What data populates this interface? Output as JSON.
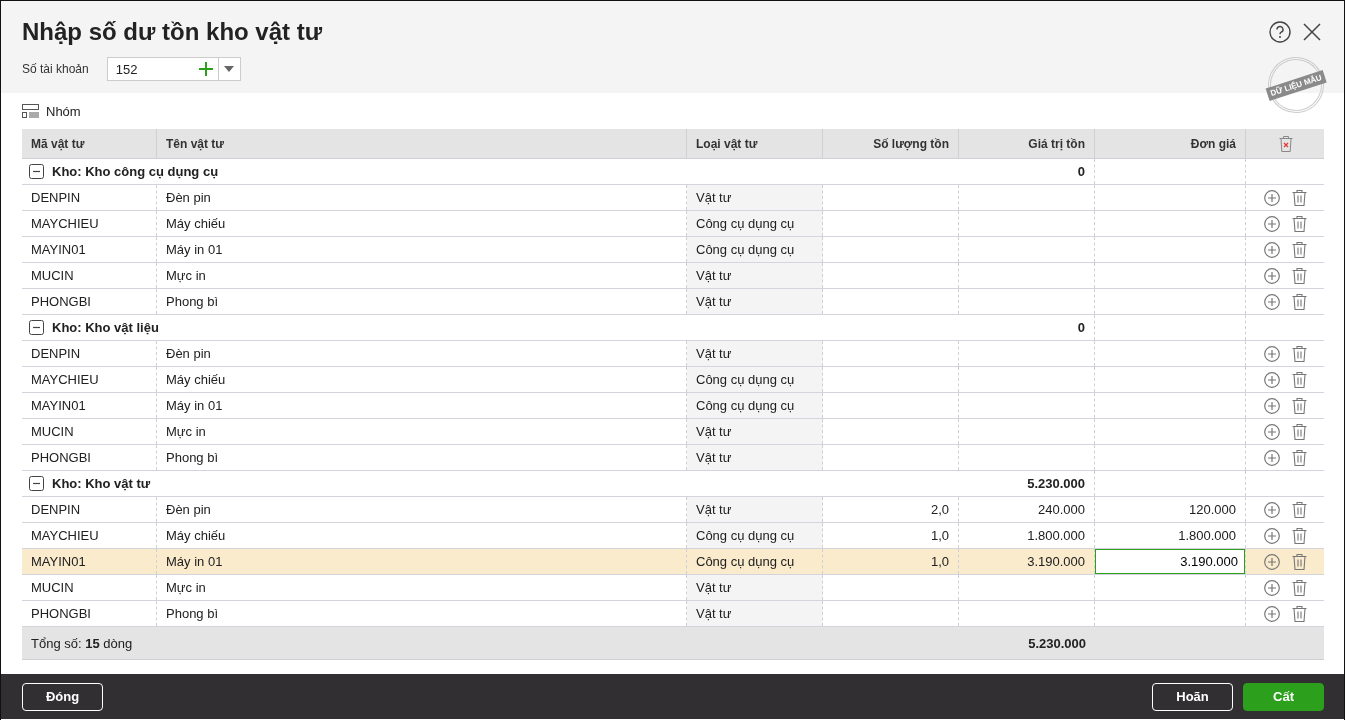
{
  "window": {
    "title": "Nhập số dư tồn kho vật tư",
    "stamp": "DỮ LIỆU MẪU"
  },
  "account": {
    "label": "Số tài khoản",
    "value": "152"
  },
  "toolbar": {
    "group_label": "Nhóm"
  },
  "table": {
    "columns": [
      "Mã vật tư",
      "Tên vật tư",
      "Loại vật tư",
      "Số lượng tồn",
      "Giá trị tồn",
      "Đơn giá"
    ],
    "groups": [
      {
        "label": "Kho: Kho công cụ dụng cụ",
        "total": "0",
        "expanded": true,
        "rows": [
          {
            "code": "DENPIN",
            "name": "Đèn pin",
            "type": "Vật tư",
            "selected": false
          },
          {
            "code": "MAYCHIEU",
            "name": "Máy chiếu",
            "type": "Công cụ dụng cụ",
            "selected": false
          },
          {
            "code": "MAYIN01",
            "name": "Máy in 01",
            "type": "Công cụ dụng cụ",
            "selected": false
          },
          {
            "code": "MUCIN",
            "name": "Mực in",
            "type": "Vật tư",
            "selected": false
          },
          {
            "code": "PHONGBI",
            "name": "Phong bì",
            "type": "Vật tư",
            "selected": false
          }
        ]
      },
      {
        "label": "Kho: Kho vật liệu",
        "total": "0",
        "expanded": true,
        "rows": [
          {
            "code": "DENPIN",
            "name": "Đèn pin",
            "type": "Vật tư",
            "selected": false
          },
          {
            "code": "MAYCHIEU",
            "name": "Máy chiếu",
            "type": "Công cụ dụng cụ",
            "selected": false
          },
          {
            "code": "MAYIN01",
            "name": "Máy in 01",
            "type": "Công cụ dụng cụ",
            "selected": false
          },
          {
            "code": "MUCIN",
            "name": "Mực in",
            "type": "Vật tư",
            "selected": false
          },
          {
            "code": "PHONGBI",
            "name": "Phong bì",
            "type": "Vật tư",
            "selected": false
          }
        ]
      },
      {
        "label": "Kho: Kho vật tư",
        "total": "5.230.000",
        "expanded": true,
        "rows": [
          {
            "code": "DENPIN",
            "name": "Đèn pin",
            "type": "Vật tư",
            "quantity": "2,0",
            "value": "240.000",
            "unit_price": "120.000",
            "selected": false
          },
          {
            "code": "MAYCHIEU",
            "name": "Máy chiếu",
            "type": "Công cụ dụng cụ",
            "quantity": "1,0",
            "value": "1.800.000",
            "unit_price": "1.800.000",
            "selected": false
          },
          {
            "code": "MAYIN01",
            "name": "Máy in 01",
            "type": "Công cụ dụng cụ",
            "quantity": "1,0",
            "value": "3.190.000",
            "unit_price": "3.190.000",
            "selected": true
          },
          {
            "code": "MUCIN",
            "name": "Mực in",
            "type": "Vật tư",
            "selected": false
          },
          {
            "code": "PHONGBI",
            "name": "Phong bì",
            "type": "Vật tư",
            "selected": false
          }
        ]
      }
    ],
    "footer": {
      "summary": "Tổng số: **15** dòng",
      "total": "5.230.000"
    }
  },
  "footer": {
    "left_buttons": [
      {
        "label": "Đóng",
        "kind": "secondary"
      }
    ],
    "right_buttons": [
      {
        "label": "Hoãn",
        "kind": "secondary"
      },
      {
        "label": "Cất",
        "kind": "primary"
      }
    ]
  }
}
